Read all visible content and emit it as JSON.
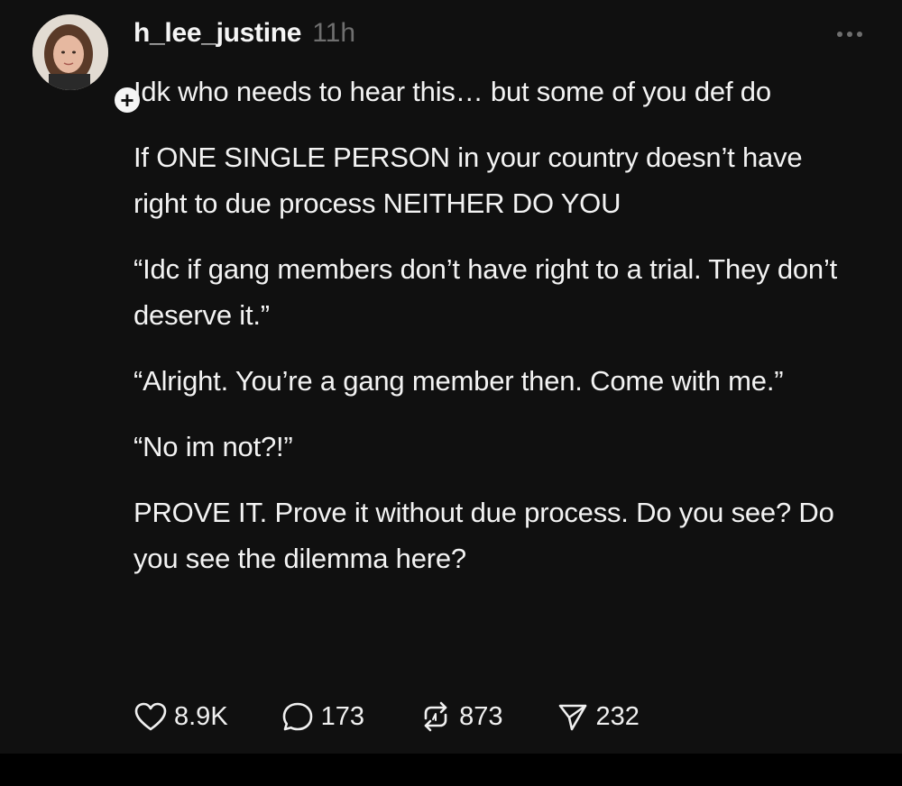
{
  "post": {
    "username": "h_lee_justine",
    "timestamp": "11h",
    "paragraphs": [
      "Idk who needs to hear this… but some of you def do",
      "If ONE SINGLE PERSON in your country doesn’t have right to due process NEITHER DO YOU",
      "“Idc if gang members don’t have right to a trial. They don’t deserve it.”",
      "“Alright. You’re a gang member then. Come with me.”",
      "“No im not?!”",
      "PROVE IT. Prove it without due process. Do you see? Do you see the dilemma here?"
    ],
    "actions": {
      "likes": "8.9K",
      "replies": "173",
      "reposts": "873",
      "shares": "232"
    }
  },
  "icons": {
    "follow": "plus-icon",
    "menu": "more-horizontal-icon",
    "like": "heart-icon",
    "reply": "comment-bubble-icon",
    "repost": "repost-arrows-icon",
    "share": "send-paper-plane-icon"
  },
  "colors": {
    "background": "#101010",
    "text": "#f3f3f3",
    "muted": "#6f6f6f"
  }
}
